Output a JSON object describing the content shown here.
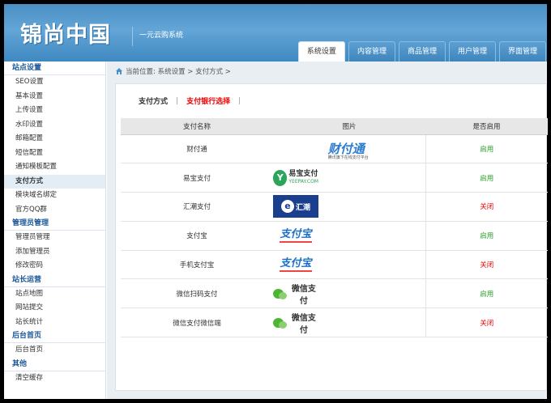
{
  "header": {
    "logo": "锦尚中国",
    "subtitle": "一元云购系统",
    "tabs": [
      {
        "label": "系统设置",
        "active": true
      },
      {
        "label": "内容管理",
        "active": false
      },
      {
        "label": "商品管理",
        "active": false
      },
      {
        "label": "用户管理",
        "active": false
      },
      {
        "label": "界面管理",
        "active": false
      }
    ]
  },
  "sidebar": {
    "sections": [
      {
        "title": "站点设置",
        "items": [
          "SEO设置",
          "基本设置",
          "上传设置",
          "水印设置",
          "邮箱配置",
          "短信配置",
          "通知模板配置",
          "支付方式",
          "模块域名绑定",
          "官方QQ群"
        ]
      },
      {
        "title": "管理员管理",
        "items": [
          "管理员管理",
          "添加管理员",
          "修改密码"
        ]
      },
      {
        "title": "站长运营",
        "items": [
          "站点地图",
          "网站提交",
          "站长统计"
        ]
      },
      {
        "title": "后台首页",
        "items": [
          "后台首页"
        ]
      },
      {
        "title": "其他",
        "items": [
          "清空缓存"
        ]
      }
    ],
    "active_item": "支付方式"
  },
  "breadcrumb": {
    "text": "当前位置: 系统设置 > 支付方式 >"
  },
  "subtabs": {
    "items": [
      "支付方式",
      "支付银行选择"
    ],
    "current": "支付银行选择",
    "separator": "|"
  },
  "table": {
    "headers": [
      "支付名称",
      "图片",
      "是否启用"
    ],
    "rows": [
      {
        "name": "财付通",
        "logo": "tenpay-logo",
        "logo_text": "财付通",
        "logo_sub": "腾讯旗下在线支付平台",
        "status": "启用",
        "enabled": true
      },
      {
        "name": "易宝支付",
        "logo": "yeepay-logo",
        "logo_text": "易宝支付",
        "logo_sub": "YEEPAY.COM",
        "status": "启用",
        "enabled": true
      },
      {
        "name": "汇潮支付",
        "logo": "ecpss-logo",
        "logo_text": "汇潮",
        "status": "关闭",
        "enabled": false
      },
      {
        "name": "支付宝",
        "logo": "alipay-logo",
        "logo_text": "支付宝",
        "status": "启用",
        "enabled": true
      },
      {
        "name": "手机支付宝",
        "logo": "alipay-logo",
        "logo_text": "支付宝",
        "status": "关闭",
        "enabled": false
      },
      {
        "name": "微信扫码支付",
        "logo": "wechat-pay-logo",
        "logo_text": "微信支付",
        "status": "启用",
        "enabled": true
      },
      {
        "name": "微信支付微信端",
        "logo": "wechat-pay-logo",
        "logo_text": "微信支付",
        "status": "关闭",
        "enabled": false
      }
    ]
  },
  "colors": {
    "header_blue": "#4a8fc5",
    "sidebar_title": "#1d5a9a",
    "enabled_green": "#2aa22a",
    "disabled_red": "#ee0000"
  }
}
